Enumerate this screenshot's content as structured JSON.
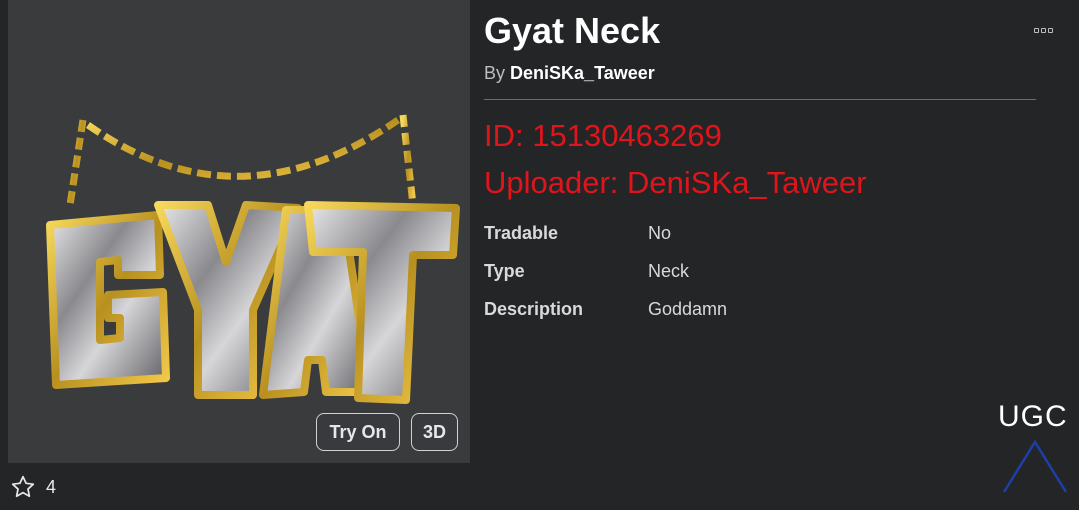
{
  "item": {
    "title": "Gyat Neck",
    "by_prefix": "By",
    "creator": "DeniSKa_Taweer"
  },
  "thumbnail": {
    "try_on_label": "Try On",
    "view_3d_label": "3D"
  },
  "favorites": {
    "count": "4"
  },
  "overlay": {
    "id_text": "ID: 15130463269",
    "uploader_text": "Uploader: DeniSKa_Taweer",
    "color": "#e0151b"
  },
  "details": [
    {
      "label": "Tradable",
      "value": "No"
    },
    {
      "label": "Type",
      "value": "Neck"
    },
    {
      "label": "Description",
      "value": "Goddamn"
    }
  ],
  "watermark": {
    "text": "UGC"
  }
}
